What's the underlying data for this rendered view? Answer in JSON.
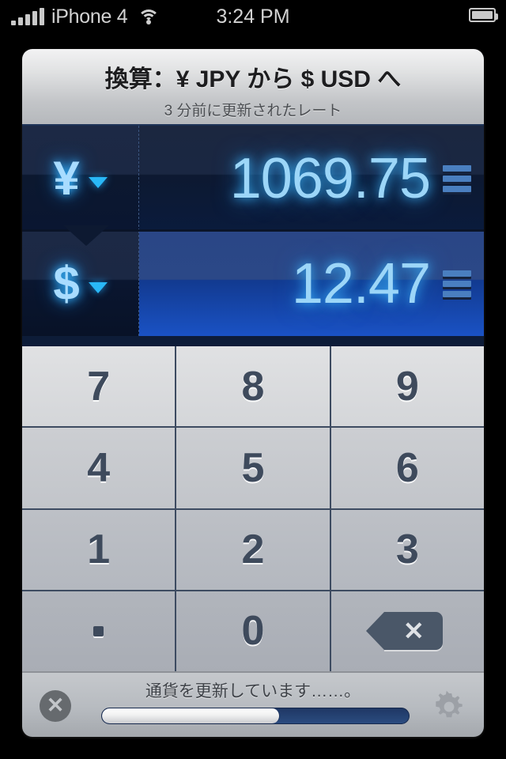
{
  "status_bar": {
    "carrier": "iPhone 4",
    "time": "3:24 PM",
    "signal_icon": "signal-bars-icon",
    "wifi_icon": "wifi-icon",
    "battery_icon": "battery-full-icon"
  },
  "header": {
    "title": "換算：¥ JPY から $ USD へ",
    "subtitle": "3 分前に更新されたレート"
  },
  "display": {
    "from": {
      "symbol": "¥",
      "code": "JPY",
      "value": "1069.75",
      "caret_icon": "chevron-down-icon",
      "menu_icon": "hamburger-menu-icon",
      "active": false
    },
    "to": {
      "symbol": "$",
      "code": "USD",
      "value": "12.47",
      "caret_icon": "chevron-down-icon",
      "menu_icon": "hamburger-menu-icon",
      "active": true
    }
  },
  "keypad": {
    "rows": [
      [
        "7",
        "8",
        "9"
      ],
      [
        "4",
        "5",
        "6"
      ],
      [
        "1",
        "2",
        "3"
      ],
      [
        ".",
        "0",
        "backspace"
      ]
    ],
    "decimal_label": ".",
    "backspace_icon": "backspace-delete-icon",
    "backspace_glyph": "✕"
  },
  "bottom_bar": {
    "cancel_icon": "cancel-close-icon",
    "cancel_glyph": "✕",
    "status_text": "通貨を更新しています……。",
    "progress_percent": 58,
    "gear_icon": "gear-settings-icon"
  },
  "colors": {
    "accent_blue": "#1a52c4",
    "glow_blue": "#9cd6f8",
    "panel_dark": "#0d1c38",
    "key_text": "#3e4a5c"
  }
}
